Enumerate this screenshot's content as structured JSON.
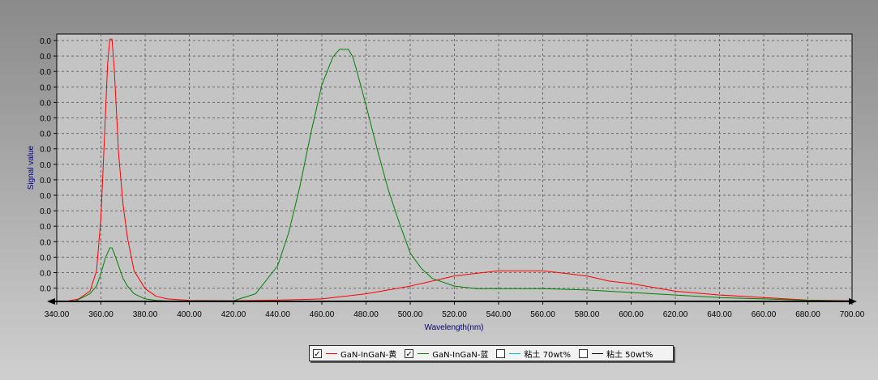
{
  "chart_data": {
    "type": "line",
    "xlabel": "Wavelength(nm)",
    "ylabel": "Signal value",
    "xlim": [
      340,
      700
    ],
    "ylim": [
      0,
      1.05
    ],
    "x_ticks": [
      "340.00",
      "360.00",
      "380.00",
      "400.00",
      "420.00",
      "440.00",
      "460.00",
      "480.00",
      "500.00",
      "520.00",
      "540.00",
      "560.00",
      "580.00",
      "600.00",
      "620.00",
      "640.00",
      "660.00",
      "680.00",
      "700.00"
    ],
    "y_tick_labels": [
      "0.0",
      "0.0",
      "0.0",
      "0.0",
      "0.0",
      "0.0",
      "0.0",
      "0.0",
      "0.0",
      "0.0",
      "0.0",
      "0.0",
      "0.0",
      "0.0",
      "0.0",
      "0.0",
      "0.0"
    ],
    "grid": true,
    "legend_position": "bottom-center",
    "series": [
      {
        "name": "GaN-InGaN-黄",
        "color": "#ff0000",
        "checked": true,
        "x": [
          344,
          350,
          355,
          358,
          360,
          362,
          363,
          364,
          365,
          366,
          367,
          368,
          370,
          372,
          375,
          380,
          385,
          390,
          400,
          420,
          440,
          460,
          480,
          500,
          510,
          520,
          530,
          540,
          550,
          560,
          570,
          580,
          590,
          600,
          620,
          640,
          660,
          680,
          700
        ],
        "y": [
          0.0,
          0.01,
          0.04,
          0.12,
          0.33,
          0.72,
          0.93,
          1.03,
          1.03,
          0.92,
          0.75,
          0.58,
          0.38,
          0.25,
          0.12,
          0.05,
          0.02,
          0.01,
          0.004,
          0.003,
          0.005,
          0.01,
          0.03,
          0.06,
          0.08,
          0.1,
          0.11,
          0.12,
          0.12,
          0.12,
          0.11,
          0.1,
          0.08,
          0.07,
          0.04,
          0.025,
          0.015,
          0.005,
          0.003
        ]
      },
      {
        "name": "GaN-InGaN-蓝",
        "color": "#008000",
        "checked": true,
        "x": [
          348,
          355,
          358,
          360,
          362,
          364,
          365,
          366,
          368,
          370,
          372,
          375,
          380,
          385,
          390,
          400,
          420,
          430,
          440,
          445,
          450,
          455,
          460,
          465,
          468,
          470,
          472,
          474,
          476,
          480,
          485,
          490,
          495,
          500,
          505,
          510,
          520,
          530,
          540,
          560,
          580,
          600,
          620,
          640,
          660,
          680,
          700
        ],
        "y": [
          0.0,
          0.03,
          0.06,
          0.11,
          0.17,
          0.21,
          0.21,
          0.19,
          0.14,
          0.09,
          0.06,
          0.03,
          0.01,
          0.004,
          0.002,
          0.002,
          0.003,
          0.03,
          0.14,
          0.27,
          0.45,
          0.66,
          0.85,
          0.96,
          0.99,
          0.99,
          0.99,
          0.96,
          0.9,
          0.77,
          0.6,
          0.44,
          0.31,
          0.19,
          0.13,
          0.09,
          0.06,
          0.05,
          0.05,
          0.05,
          0.045,
          0.035,
          0.025,
          0.015,
          0.01,
          0.004,
          0.002
        ]
      },
      {
        "name": "粘土 70wt%",
        "color": "#00cccc",
        "checked": false
      },
      {
        "name": "粘土 50wt%",
        "color": "#000000",
        "checked": false
      }
    ]
  },
  "legend": {
    "check_mark": "✓"
  }
}
